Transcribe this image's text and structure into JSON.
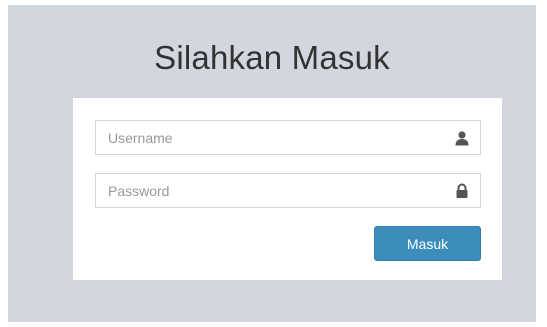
{
  "page": {
    "title": "Silahkan Masuk"
  },
  "form": {
    "username": {
      "placeholder": "Username",
      "value": "",
      "icon": "user-icon"
    },
    "password": {
      "placeholder": "Password",
      "value": "",
      "icon": "lock-icon"
    },
    "submit_label": "Masuk"
  },
  "colors": {
    "background": "#d2d6de",
    "box": "#ffffff",
    "accent": "#3c8dbc",
    "icon": "#555555"
  }
}
